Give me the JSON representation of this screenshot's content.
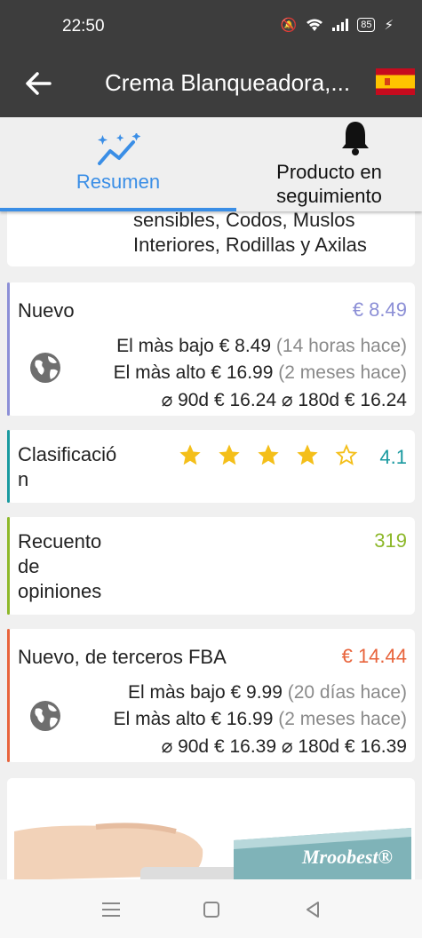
{
  "status": {
    "time": "22:50",
    "battery": "85"
  },
  "appbar": {
    "title": "Crema Blanqueadora,...",
    "flag": "Spain flag"
  },
  "tabs": [
    {
      "label": "Resumen",
      "icon": "trending-icon",
      "active": true
    },
    {
      "label": "Producto en seguimiento",
      "icon": "bell-icon",
      "active": false
    }
  ],
  "description": {
    "line1": "sensibles, Codos, Muslos",
    "line2": "Interiores, Rodillas y Axilas"
  },
  "new_price": {
    "title": "Nuevo",
    "value": "€ 8.49",
    "color": "#8c8fd6",
    "lowest_label": "El màs bajo",
    "lowest_price": "€ 8.49",
    "lowest_when": "(14 horas hace)",
    "highest_label": "El màs alto",
    "highest_price": "€ 16.99",
    "highest_when": "(2 meses hace)",
    "avg90_label": "⌀ 90d",
    "avg90": "€ 16.24",
    "avg180_label": "⌀ 180d",
    "avg180": "€ 16.24"
  },
  "rating": {
    "title": "Clasificación",
    "value": "4.1",
    "stars": 4.1,
    "color": "#1a9aa0"
  },
  "reviews": {
    "title": "Recuento de opiniones",
    "value": "319",
    "color": "#8db82a"
  },
  "fba": {
    "title": "Nuevo, de terceros FBA",
    "value": "€ 14.44",
    "color": "#e8643c",
    "lowest_label": "El màs bajo",
    "lowest_price": "€ 9.99",
    "lowest_when": "(20 días hace)",
    "highest_label": "El màs alto",
    "highest_price": "€ 16.99",
    "highest_when": "(2 meses hace)",
    "avg90_label": "⌀ 90d",
    "avg90": "€ 16.39",
    "avg180_label": "⌀ 180d",
    "avg180": "€ 16.39"
  },
  "product_image": {
    "brand": "Mroobest®"
  }
}
